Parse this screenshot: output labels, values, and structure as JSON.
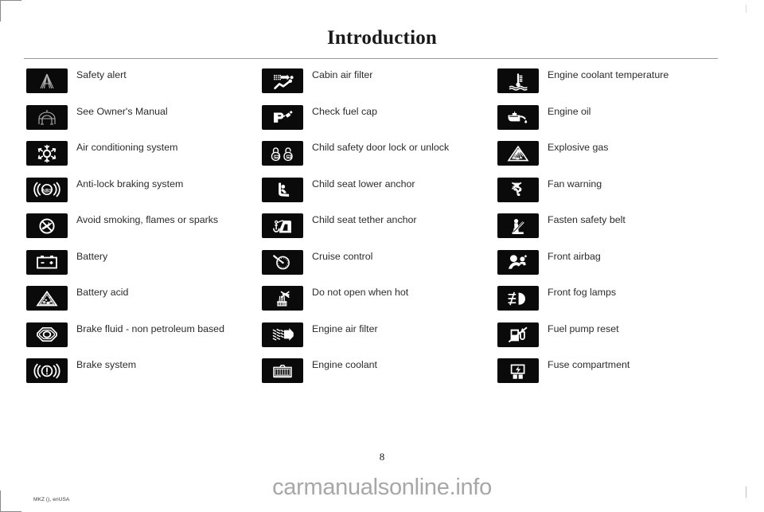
{
  "page": {
    "title": "Introduction",
    "page_number": "8",
    "doc_code": "MKZ (), enUSA",
    "watermark": "carmanualsonline.info"
  },
  "columns": [
    {
      "name": "column-left",
      "items": [
        {
          "label": "Safety alert",
          "icon": "safety-alert-icon"
        },
        {
          "label": "See Owner's Manual",
          "icon": "see-owners-manual-icon"
        },
        {
          "label": "Air conditioning system",
          "icon": "air-conditioning-snowflake-icon"
        },
        {
          "label": "Anti-lock braking system",
          "icon": "abs-icon"
        },
        {
          "label": "Avoid smoking, flames or sparks",
          "icon": "no-smoking-icon"
        },
        {
          "label": "Battery",
          "icon": "battery-icon"
        },
        {
          "label": "Battery acid",
          "icon": "battery-acid-icon"
        },
        {
          "label": "Brake fluid - non petroleum based",
          "icon": "brake-fluid-icon"
        },
        {
          "label": "Brake system",
          "icon": "brake-system-icon"
        }
      ]
    },
    {
      "name": "column-middle",
      "items": [
        {
          "label": "Cabin air filter",
          "icon": "cabin-air-filter-icon"
        },
        {
          "label": "Check fuel cap",
          "icon": "check-fuel-cap-icon"
        },
        {
          "label": "Child safety door lock or unlock",
          "icon": "child-safety-door-lock-icon"
        },
        {
          "label": "Child seat lower anchor",
          "icon": "child-seat-lower-anchor-icon"
        },
        {
          "label": "Child seat tether anchor",
          "icon": "child-seat-tether-anchor-icon"
        },
        {
          "label": "Cruise control",
          "icon": "cruise-control-icon"
        },
        {
          "label": "Do not open when hot",
          "icon": "do-not-open-when-hot-icon"
        },
        {
          "label": "Engine air filter",
          "icon": "engine-air-filter-icon"
        },
        {
          "label": "Engine coolant",
          "icon": "engine-coolant-icon"
        }
      ]
    },
    {
      "name": "column-right",
      "items": [
        {
          "label": "Engine coolant temperature",
          "icon": "engine-coolant-temperature-icon"
        },
        {
          "label": "Engine oil",
          "icon": "engine-oil-icon"
        },
        {
          "label": "Explosive gas",
          "icon": "explosive-gas-icon"
        },
        {
          "label": "Fan warning",
          "icon": "fan-warning-icon"
        },
        {
          "label": "Fasten safety belt",
          "icon": "fasten-safety-belt-icon"
        },
        {
          "label": "Front airbag",
          "icon": "front-airbag-icon"
        },
        {
          "label": "Front fog lamps",
          "icon": "front-fog-lamps-icon"
        },
        {
          "label": "Fuel pump reset",
          "icon": "fuel-pump-reset-icon"
        },
        {
          "label": "Fuse compartment",
          "icon": "fuse-compartment-icon"
        }
      ]
    }
  ],
  "colors": {
    "icon_background": "#0a0a0a",
    "icon_glyph": "#ffffff",
    "text": "#2b2b2b",
    "rule": "#9a9a9a",
    "watermark": "#a7a7a7"
  }
}
